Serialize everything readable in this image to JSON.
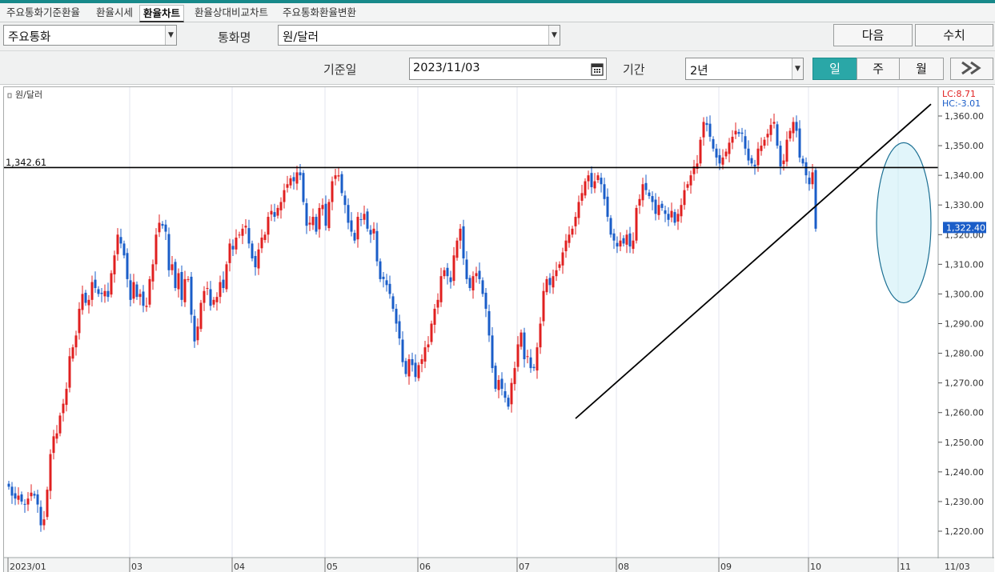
{
  "tabs": [
    {
      "label": "주요통화기준환율"
    },
    {
      "label": "환율시세"
    },
    {
      "label": "환율차트"
    },
    {
      "label": "환율상대비교차트"
    },
    {
      "label": "주요통화환율변환"
    }
  ],
  "controls": {
    "group_select": "주요통화",
    "currency_label": "통화명",
    "currency_select": "원/달러",
    "next_button": "다음",
    "values_button": "수치",
    "base_date_label": "기준일",
    "base_date": "2023/11/03",
    "period_label": "기간",
    "period_select": "2년",
    "unit_day": "일",
    "unit_week": "주",
    "unit_month": "월",
    "unit_selected": "일"
  },
  "colors": {
    "up": "#e02020",
    "down": "#1a5dc8",
    "accent": "#17898a",
    "highlight_fill": "#c8ecf5",
    "highlight_stroke": "#1b6f93"
  },
  "chart_data": {
    "type": "candlestick",
    "legend": "원/달러",
    "lc_label": "LC:8.71",
    "hc_label": "HC:-3.01",
    "horizontal_line": {
      "value": 1342.61,
      "label": "1,342.61"
    },
    "current_price": {
      "value": 1322.4,
      "label": "1,322.40"
    },
    "ylim": [
      1215,
      1366
    ],
    "y_ticks": [
      {
        "v": 1220,
        "label": "1,220.00"
      },
      {
        "v": 1230,
        "label": "1,230.00"
      },
      {
        "v": 1240,
        "label": "1,240.00"
      },
      {
        "v": 1250,
        "label": "1,250.00"
      },
      {
        "v": 1260,
        "label": "1,260.00"
      },
      {
        "v": 1270,
        "label": "1,270.00"
      },
      {
        "v": 1280,
        "label": "1,280.00"
      },
      {
        "v": 1290,
        "label": "1,290.00"
      },
      {
        "v": 1300,
        "label": "1,300.00"
      },
      {
        "v": 1310,
        "label": "1,310.00"
      },
      {
        "v": 1320,
        "label": "1,320.00"
      },
      {
        "v": 1330,
        "label": "1,330.00"
      },
      {
        "v": 1340,
        "label": "1,340.00"
      },
      {
        "v": 1350,
        "label": "1,350.00"
      },
      {
        "v": 1360,
        "label": "1,360.00"
      }
    ],
    "months": [
      {
        "label": "2023/01",
        "start": 0
      },
      {
        "label": "03",
        "start": 38
      },
      {
        "label": "04",
        "start": 70
      },
      {
        "label": "05",
        "start": 99
      },
      {
        "label": "06",
        "start": 128
      },
      {
        "label": "07",
        "start": 159
      },
      {
        "label": "08",
        "start": 190
      },
      {
        "label": "09",
        "start": 222
      },
      {
        "label": "10",
        "start": 250
      },
      {
        "label": "11",
        "start": 278
      }
    ],
    "end_date_label": "11/03",
    "trend_lines": [
      {
        "from": {
          "index": 177,
          "value": 1258
        },
        "to": {
          "index": 288,
          "value": 1364
        }
      }
    ],
    "highlight": {
      "from_index": 271,
      "to_index": 288,
      "center": 1324,
      "radius": 27
    },
    "close": [
      1235,
      1232,
      1231,
      1232,
      1230,
      1229,
      1231,
      1233,
      1232,
      1229,
      1222,
      1224,
      1234,
      1246,
      1252,
      1253,
      1259,
      1263,
      1268,
      1279,
      1282,
      1286,
      1295,
      1300,
      1297,
      1298,
      1304,
      1302,
      1300,
      1300,
      1301,
      1299,
      1307,
      1313,
      1320,
      1317,
      1313,
      1305,
      1298,
      1304,
      1299,
      1300,
      1296,
      1296,
      1305,
      1310,
      1320,
      1324,
      1323,
      1321,
      1308,
      1310,
      1302,
      1307,
      1298,
      1305,
      1305,
      1293,
      1284,
      1289,
      1297,
      1301,
      1302,
      1296,
      1298,
      1299,
      1304,
      1302,
      1310,
      1317,
      1315,
      1319,
      1320,
      1322,
      1323,
      1317,
      1312,
      1309,
      1315,
      1319,
      1320,
      1326,
      1328,
      1326,
      1329,
      1331,
      1335,
      1337,
      1339,
      1338,
      1341,
      1340,
      1331,
      1323,
      1324,
      1326,
      1321,
      1329,
      1330,
      1323,
      1331,
      1338,
      1340,
      1340,
      1334,
      1330,
      1324,
      1321,
      1318,
      1326,
      1325,
      1327,
      1322,
      1320,
      1322,
      1311,
      1305,
      1305,
      1303,
      1300,
      1295,
      1290,
      1285,
      1277,
      1273,
      1278,
      1276,
      1272,
      1276,
      1278,
      1282,
      1283,
      1290,
      1295,
      1298,
      1306,
      1308,
      1306,
      1304,
      1313,
      1318,
      1322,
      1312,
      1305,
      1302,
      1306,
      1307,
      1305,
      1300,
      1295,
      1286,
      1275,
      1268,
      1271,
      1268,
      1265,
      1262,
      1270,
      1275,
      1283,
      1287,
      1278,
      1279,
      1275,
      1275,
      1282,
      1290,
      1301,
      1305,
      1303,
      1306,
      1308,
      1310,
      1314,
      1318,
      1320,
      1322,
      1326,
      1331,
      1334,
      1338,
      1340,
      1336,
      1338,
      1340,
      1337,
      1332,
      1326,
      1320,
      1318,
      1316,
      1318,
      1317,
      1320,
      1316,
      1318,
      1329,
      1332,
      1337,
      1335,
      1333,
      1331,
      1327,
      1330,
      1329,
      1327,
      1325,
      1328,
      1324,
      1327,
      1330,
      1335,
      1337,
      1340,
      1343,
      1344,
      1352,
      1358,
      1357,
      1353,
      1349,
      1346,
      1344,
      1346,
      1348,
      1351,
      1353,
      1355,
      1354,
      1354,
      1349,
      1345,
      1344,
      1343,
      1349,
      1350,
      1352,
      1354,
      1357,
      1358,
      1350,
      1343,
      1345,
      1352,
      1355,
      1358,
      1355,
      1346,
      1344,
      1340,
      1337,
      1341,
      1322
    ]
  }
}
